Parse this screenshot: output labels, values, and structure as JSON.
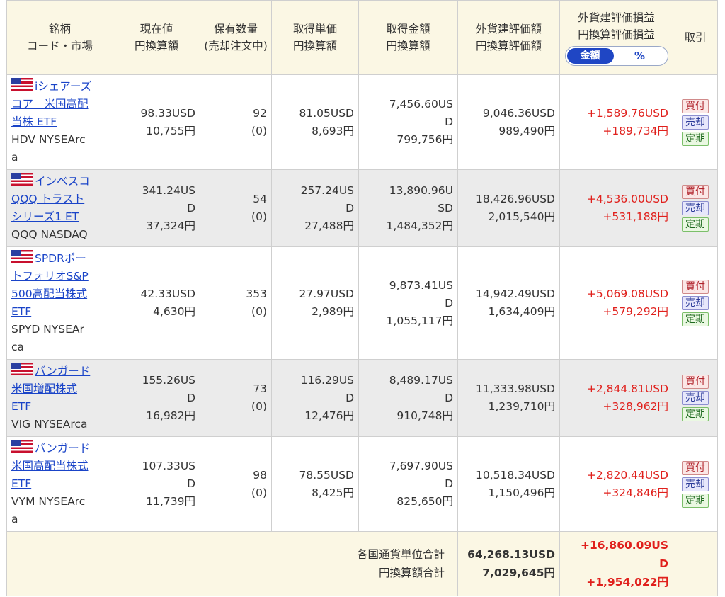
{
  "header": {
    "col1_line1": "銘柄",
    "col1_line2": "コード・市場",
    "col2_line1": "現在値",
    "col2_line2": "円換算額",
    "col3_line1": "保有数量",
    "col3_line2": "(売却注文中)",
    "col4_line1": "取得単価",
    "col4_line2": "円換算額",
    "col5_line1": "取得金額",
    "col5_line2": "円換算額",
    "col6_line1": "外貨建評価額",
    "col6_line2": "円換算評価額",
    "col7_line1": "外貨建評価損益",
    "col7_line2": "円換算評価損益",
    "toggle_amount": "金額",
    "toggle_percent": "%",
    "col8": "取引"
  },
  "buttons": {
    "buy": "買付",
    "sell": "売却",
    "regular": "定期"
  },
  "rows": [
    {
      "name_lines": [
        "iシェアーズ",
        "コア　米国高配",
        "当株 ETF"
      ],
      "code_lines": [
        "HDV NYSEArc",
        "a"
      ],
      "price_lines": [
        "98.33USD",
        "10,755円"
      ],
      "qty_lines": [
        "92",
        "(0)"
      ],
      "unit_lines": [
        "81.05USD",
        "8,693円"
      ],
      "cost_lines": [
        "7,456.60US",
        "D",
        "799,756円"
      ],
      "value_lines": [
        "9,046.36USD",
        "989,490円"
      ],
      "pl_lines": [
        "+1,589.76USD",
        "+189,734円"
      ]
    },
    {
      "name_lines": [
        "インベスコ",
        "QQQ トラスト",
        "シリーズ1 ET"
      ],
      "code_lines": [
        "QQQ NASDAQ"
      ],
      "price_lines": [
        "341.24US",
        "D",
        "37,324円"
      ],
      "qty_lines": [
        "54",
        "(0)"
      ],
      "unit_lines": [
        "257.24US",
        "D",
        "27,488円"
      ],
      "cost_lines": [
        "13,890.96U",
        "SD",
        "1,484,352円"
      ],
      "value_lines": [
        "18,426.96USD",
        "2,015,540円"
      ],
      "pl_lines": [
        "+4,536.00USD",
        "+531,188円"
      ]
    },
    {
      "name_lines": [
        "SPDRポー",
        "トフォリオS&P",
        "500高配当株式",
        "ETF"
      ],
      "code_lines": [
        "SPYD NYSEAr",
        "ca"
      ],
      "price_lines": [
        "42.33USD",
        "4,630円"
      ],
      "qty_lines": [
        "353",
        "(0)"
      ],
      "unit_lines": [
        "27.97USD",
        "2,989円"
      ],
      "cost_lines": [
        "9,873.41US",
        "D",
        "1,055,117円"
      ],
      "value_lines": [
        "14,942.49USD",
        "1,634,409円"
      ],
      "pl_lines": [
        "+5,069.08USD",
        "+579,292円"
      ]
    },
    {
      "name_lines": [
        "バンガード",
        "米国増配株式",
        "ETF"
      ],
      "code_lines": [
        "VIG NYSEArca"
      ],
      "price_lines": [
        "155.26US",
        "D",
        "16,982円"
      ],
      "qty_lines": [
        "73",
        "(0)"
      ],
      "unit_lines": [
        "116.29US",
        "D",
        "12,476円"
      ],
      "cost_lines": [
        "8,489.17US",
        "D",
        "910,748円"
      ],
      "value_lines": [
        "11,333.98USD",
        "1,239,710円"
      ],
      "pl_lines": [
        "+2,844.81USD",
        "+328,962円"
      ]
    },
    {
      "name_lines": [
        "バンガード",
        "米国高配当株式",
        "ETF"
      ],
      "code_lines": [
        "VYM NYSEArc",
        "a"
      ],
      "price_lines": [
        "107.33US",
        "D",
        "11,739円"
      ],
      "qty_lines": [
        "98",
        "(0)"
      ],
      "unit_lines": [
        "78.55USD",
        "8,425円"
      ],
      "cost_lines": [
        "7,697.90US",
        "D",
        "825,650円"
      ],
      "value_lines": [
        "10,518.34USD",
        "1,150,496円"
      ],
      "pl_lines": [
        "+2,820.44USD",
        "+324,846円"
      ]
    }
  ],
  "footer": {
    "label_line1": "各国通貨単位合計",
    "label_line2": "円換算額合計",
    "total_line1": "64,268.13USD",
    "total_line2": "7,029,645円",
    "pl_line1": "+16,860.09US",
    "pl_line2": "D",
    "pl_line3": "+1,954,022円"
  },
  "colors": {
    "header_bg": "#fbf7e4",
    "row_alt_bg": "#ebebeb",
    "link": "#1a44c8",
    "gain": "#e0201c",
    "toggle_active": "#1f46c4"
  }
}
